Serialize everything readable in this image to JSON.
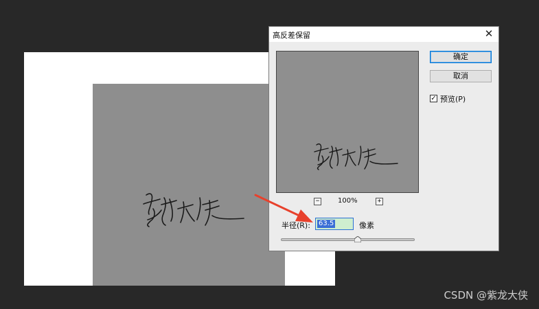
{
  "dialog": {
    "title": "高反差保留",
    "close_icon": "close-icon",
    "zoom": {
      "out_label": "−",
      "in_label": "+",
      "value": "100%"
    },
    "buttons": {
      "ok": "确定",
      "cancel": "取消"
    },
    "preview_option": {
      "label": "预览(P)",
      "checked": true,
      "check_glyph": "✓"
    },
    "radius": {
      "label": "半径(R):",
      "value": "63.5",
      "unit": "像素",
      "slider_position_fraction": 0.6
    }
  },
  "colors": {
    "workspace": "#282828",
    "dialog_bg": "#ececec",
    "photo_gray": "#8e8e8e",
    "highlight": "#3b6fd6",
    "annotation_arrow": "#e8412c"
  },
  "watermark": "CSDN @紫龙大侠"
}
